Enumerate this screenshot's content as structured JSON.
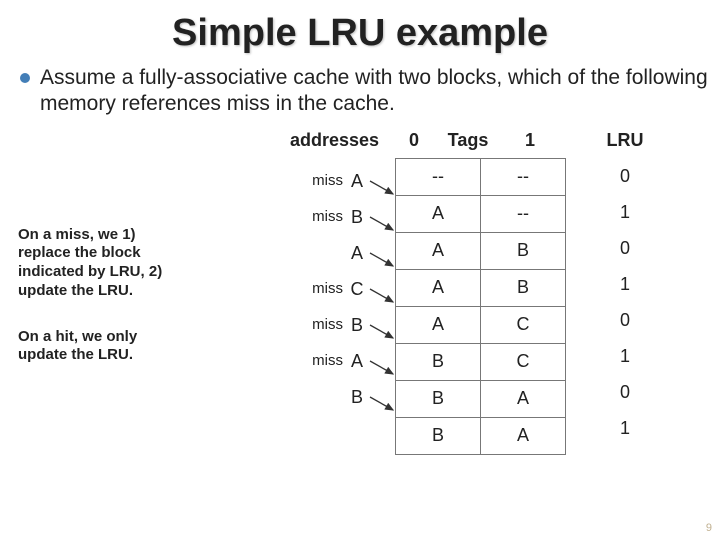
{
  "title": "Simple LRU example",
  "bullet": "Assume a fully-associative cache with two blocks, which of the following memory references miss in the cache.",
  "note1_a": "On a miss, we 1) replace the block indicated by LRU, 2) update the LRU.",
  "note2": "On a hit, we only update the LRU.",
  "labels": {
    "addresses": "addresses",
    "tags0": "0",
    "tagsWord": "Tags",
    "tags1": "1",
    "lru": "LRU"
  },
  "refs": [
    {
      "miss": "miss",
      "ref": "A"
    },
    {
      "miss": "miss",
      "ref": "B"
    },
    {
      "miss": "",
      "ref": "A"
    },
    {
      "miss": "miss",
      "ref": "C"
    },
    {
      "miss": "miss",
      "ref": "B"
    },
    {
      "miss": "miss",
      "ref": "A"
    },
    {
      "miss": "",
      "ref": "B"
    }
  ],
  "rows": [
    {
      "t0": "--",
      "t1": "--",
      "lru": "0"
    },
    {
      "t0": "A",
      "t1": "--",
      "lru": "1"
    },
    {
      "t0": "A",
      "t1": "B",
      "lru": "0"
    },
    {
      "t0": "A",
      "t1": "B",
      "lru": "1"
    },
    {
      "t0": "A",
      "t1": "C",
      "lru": "0"
    },
    {
      "t0": "B",
      "t1": "C",
      "lru": "1"
    },
    {
      "t0": "B",
      "t1": "A",
      "lru": "0"
    },
    {
      "t0": "B",
      "t1": "A",
      "lru": "1"
    }
  ],
  "page": "9"
}
